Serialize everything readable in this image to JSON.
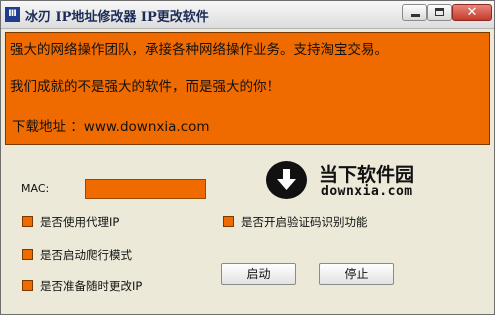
{
  "window": {
    "icon_text": "Ⅲ",
    "title": "冰刃 IP地址修改器 IP更改软件",
    "close_glyph": "✕"
  },
  "banner": {
    "line1": "强大的网络操作团队，承接各种网络操作业务。支持淘宝交易。",
    "line2": "我们成就的不是强大的软件，而是强大的你！",
    "line3": "下载地址 ：www.downxia.com",
    "background_color": "#ef6b00"
  },
  "mac": {
    "label": "MAC:",
    "value": ""
  },
  "logo": {
    "title": "当下软件园",
    "subtitle": "downxia.com",
    "icon": "download-arrow-icon"
  },
  "options": {
    "use_proxy": "是否使用代理IP",
    "start_crawler": "是否启动爬行模式",
    "change_ip_anytime": "是否准备随时更改IP",
    "captcha_recognition": "是否开启验证码识别功能"
  },
  "buttons": {
    "start": "启动",
    "stop": "停止"
  },
  "colors": {
    "accent": "#ef6b00",
    "window_bg": "#ece9d8"
  }
}
